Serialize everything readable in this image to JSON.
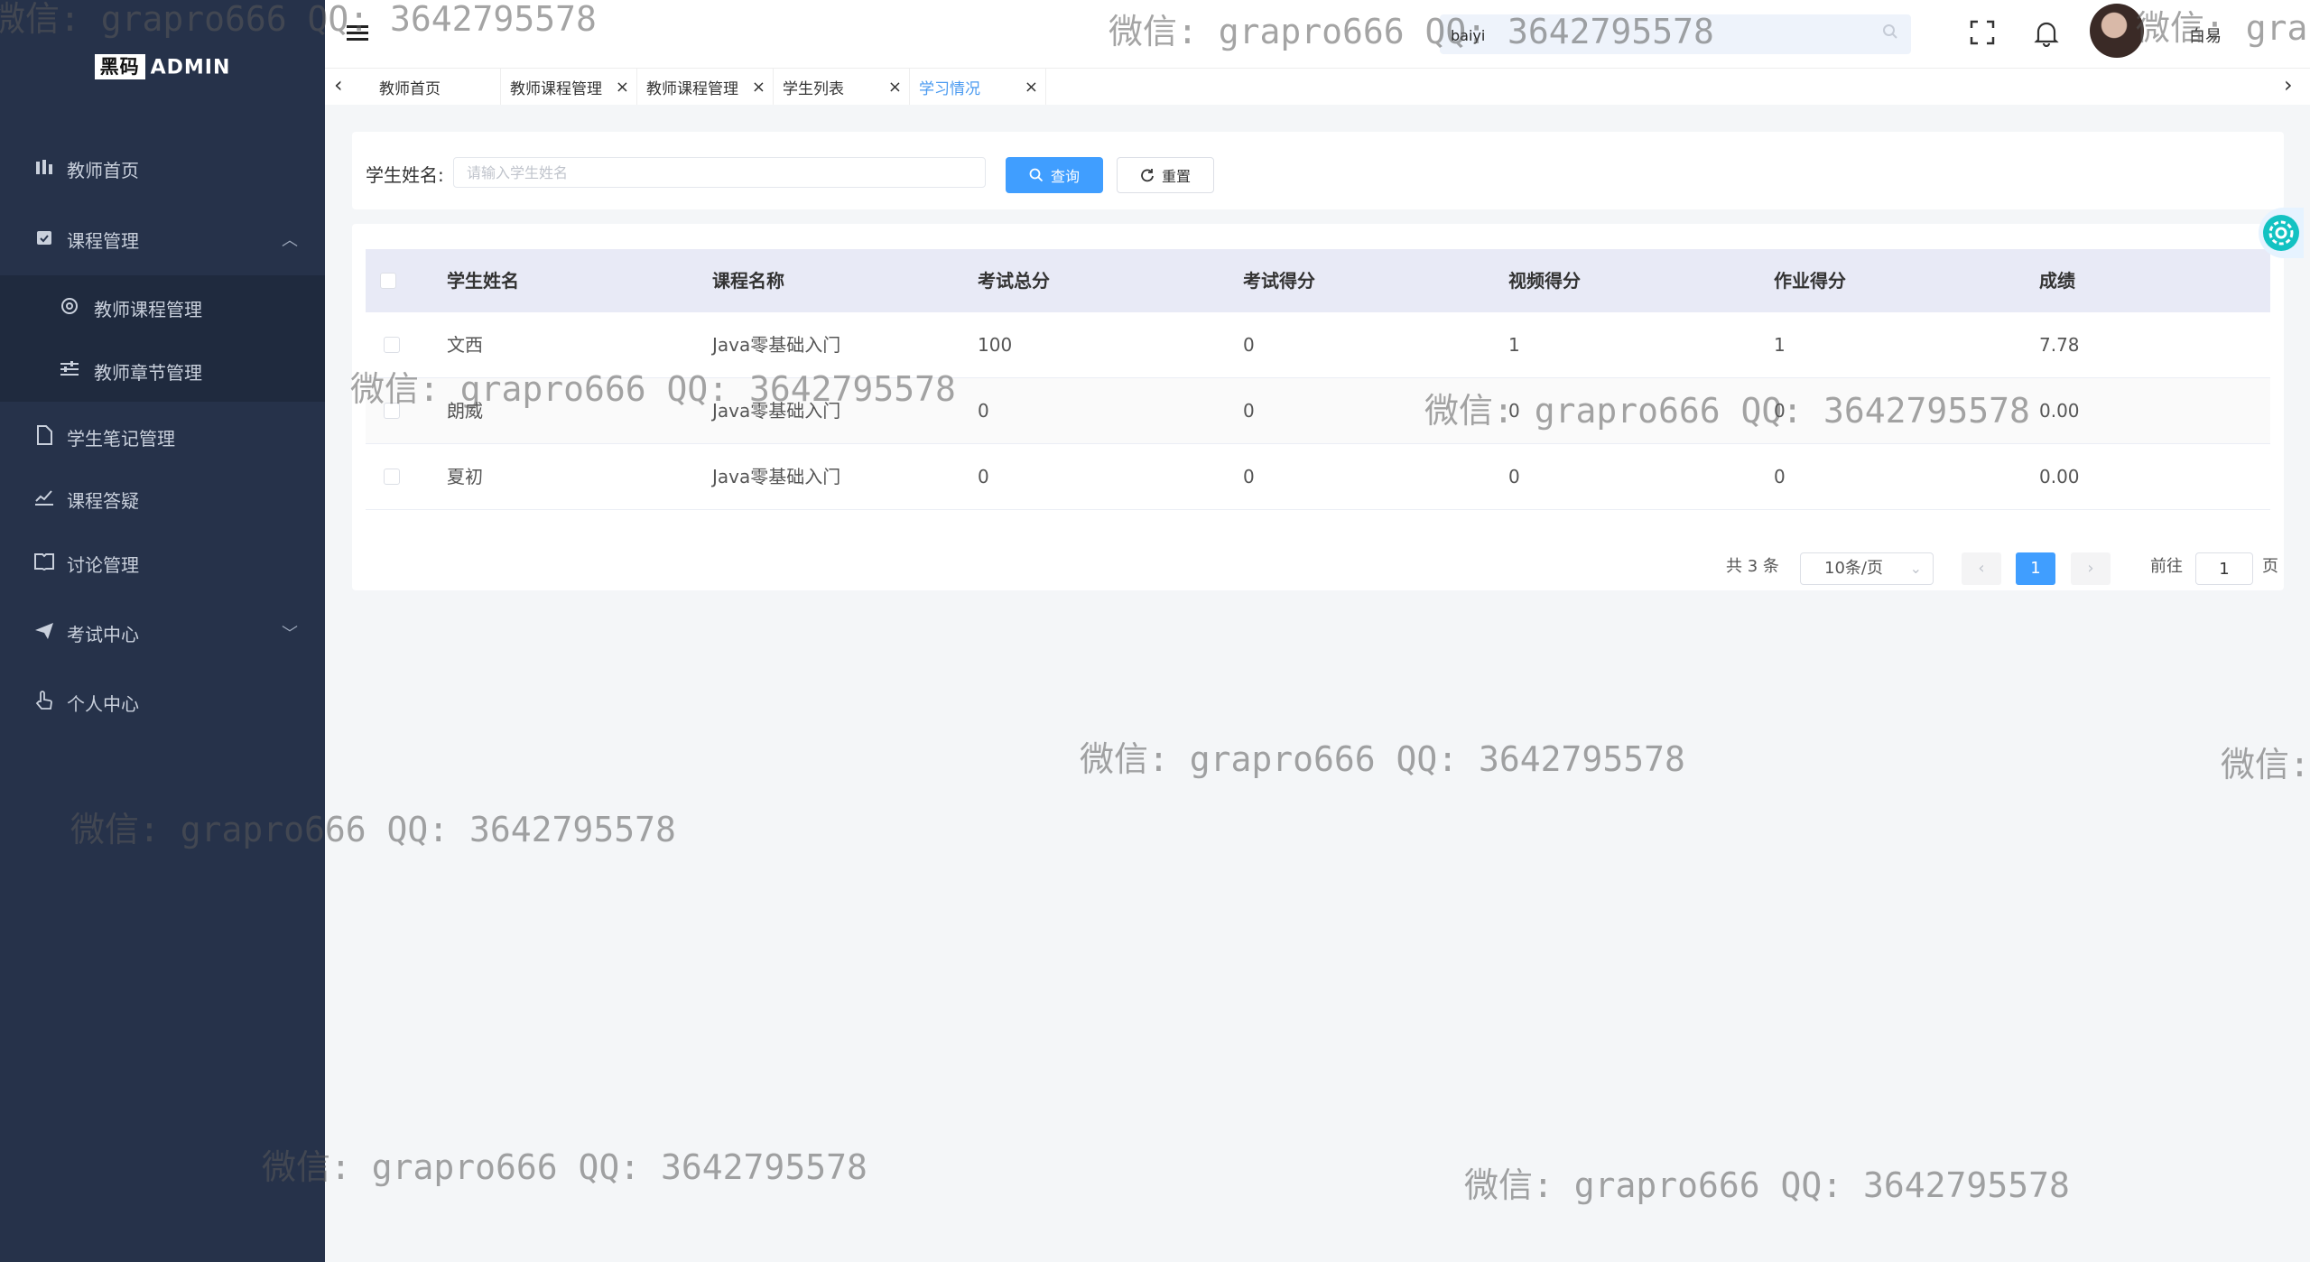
{
  "sidebar": {
    "logo_box": "黑码",
    "logo_text": "ADMIN",
    "items": [
      {
        "label": "教师首页",
        "icon": "bar-chart-icon"
      },
      {
        "label": "课程管理",
        "icon": "calendar-check-icon"
      },
      {
        "label": "教师课程管理",
        "icon": "gear-icon"
      },
      {
        "label": "教师章节管理",
        "icon": "sliders-icon"
      },
      {
        "label": "学生笔记管理",
        "icon": "document-icon"
      },
      {
        "label": "课程答疑",
        "icon": "chart-line-icon"
      },
      {
        "label": "讨论管理",
        "icon": "book-open-icon"
      },
      {
        "label": "考试中心",
        "icon": "paper-plane-icon"
      },
      {
        "label": "个人中心",
        "icon": "hand-icon"
      }
    ]
  },
  "header": {
    "search_value": "baiyi",
    "username": "白易"
  },
  "tabs": [
    {
      "label": "教师首页"
    },
    {
      "label": "教师课程管理",
      "close": "×"
    },
    {
      "label": "教师课程管理",
      "close": "×"
    },
    {
      "label": "学生列表",
      "close": "×"
    },
    {
      "label": "学习情况",
      "close": "×"
    }
  ],
  "filter": {
    "label": "学生姓名:",
    "placeholder": "请输入学生姓名",
    "query_label": "查询",
    "reset_label": "重置"
  },
  "table": {
    "columns": [
      "学生姓名",
      "课程名称",
      "考试总分",
      "考试得分",
      "视频得分",
      "作业得分",
      "成绩"
    ],
    "rows": [
      [
        "文西",
        "Java零基础入门",
        "100",
        "0",
        "1",
        "1",
        "7.78"
      ],
      [
        "朗威",
        "Java零基础入门",
        "0",
        "0",
        "0",
        "0",
        "0.00"
      ],
      [
        "夏初",
        "Java零基础入门",
        "0",
        "0",
        "0",
        "0",
        "0.00"
      ]
    ]
  },
  "pagination": {
    "total": "共 3 条",
    "page_size": "10条/页",
    "prev": "‹",
    "current": "1",
    "next": "›",
    "goto_label": "前往",
    "goto_value": "1",
    "page_suffix": "页"
  },
  "watermark": "微信: grapro666 QQ: 3642795578",
  "colors": {
    "sidebar_bg": "#26324a",
    "primary": "#409eff",
    "table_header_bg": "#e8eaf6"
  }
}
